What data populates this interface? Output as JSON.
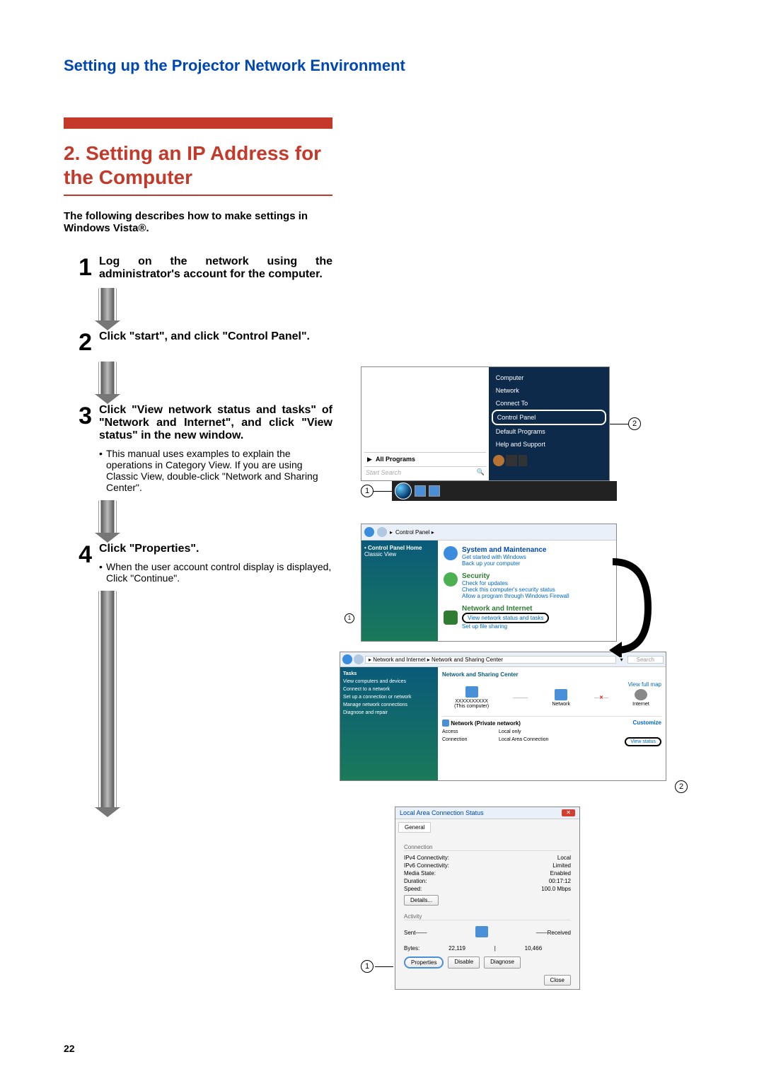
{
  "page": {
    "header": "Setting up the Projector Network Environment",
    "section_number": "2. Setting an IP Address for the Computer",
    "intro": "The following describes how to make settings in Windows Vista®.",
    "page_number": "22"
  },
  "steps": {
    "s1": {
      "num": "1",
      "title": "Log on the network using the administrator's account for the computer."
    },
    "s2": {
      "num": "2",
      "title": "Click \"start\", and click \"Control Panel\"."
    },
    "s3": {
      "num": "3",
      "title": "Click \"View network status and tasks\" of \"Network and Internet\", and click \"View status\" in the new window.",
      "bullet": "This manual uses examples to explain the operations in Category View. If you are using Classic View, double-click \"Network and Sharing Center\"."
    },
    "s4": {
      "num": "4",
      "title": "Click \"Properties\".",
      "bullet": "When the user account control display is displayed, Click \"Continue\"."
    }
  },
  "markers": {
    "m1": "1",
    "m2": "2"
  },
  "fig2": {
    "computer": "Computer",
    "network": "Network",
    "connect_to": "Connect To",
    "control_panel": "Control Panel",
    "default_programs": "Default Programs",
    "help": "Help and Support",
    "all_programs": "All Programs",
    "start_search": "Start Search",
    "search_icon": "🔍"
  },
  "fig3": {
    "addr": "Control Panel  ▸",
    "side_home": "Control Panel Home",
    "side_classic": "Classic View",
    "sysmaint": "System and Maintenance",
    "sysmaint_sub1": "Get started with Windows",
    "sysmaint_sub2": "Back up your computer",
    "security": "Security",
    "security_sub1": "Check for updates",
    "security_sub2": "Check this computer's security status",
    "security_sub3": "Allow a program through Windows Firewall",
    "netint": "Network and Internet",
    "netint_sub1": "View network status and tasks",
    "netint_sub2": "Set up file sharing",
    "nsc_addr": "▸ Network and Internet ▸ Network and Sharing Center",
    "nsc_search": "Search",
    "nsc_side_tasks": "Tasks",
    "nsc_side1": "View computers and devices",
    "nsc_side2": "Connect to a network",
    "nsc_side3": "Set up a connection or network",
    "nsc_side4": "Manage network connections",
    "nsc_side5": "Diagnose and repair",
    "nsc_title": "Network and Sharing Center",
    "nsc_fullmap": "View full map",
    "nsc_thiscomp": "(This computer)",
    "nsc_name": "XXXXXXXXXX",
    "nsc_network": "Network",
    "nsc_internet": "Internet",
    "nsc_netlabel": "Network (Private network)",
    "nsc_customize": "Customize",
    "nsc_access": "Access",
    "nsc_access_v": "Local only",
    "nsc_conn": "Connection",
    "nsc_conn_v": "Local Area Connection",
    "nsc_viewstatus": "View status"
  },
  "fig4": {
    "title": "Local Area Connection Status",
    "tab": "General",
    "grp_conn": "Connection",
    "ipv4": "IPv4 Connectivity:",
    "ipv4_v": "Local",
    "ipv6": "IPv6 Connectivity:",
    "ipv6_v": "Limited",
    "media": "Media State:",
    "media_v": "Enabled",
    "duration": "Duration:",
    "duration_v": "00:17:12",
    "speed": "Speed:",
    "speed_v": "100.0 Mbps",
    "details": "Details...",
    "grp_act": "Activity",
    "sent": "Sent",
    "received": "Received",
    "bytes": "Bytes:",
    "bytes_sent": "22,119",
    "bytes_recv": "10,466",
    "properties": "Properties",
    "disable": "Disable",
    "diagnose": "Diagnose",
    "close": "Close"
  }
}
